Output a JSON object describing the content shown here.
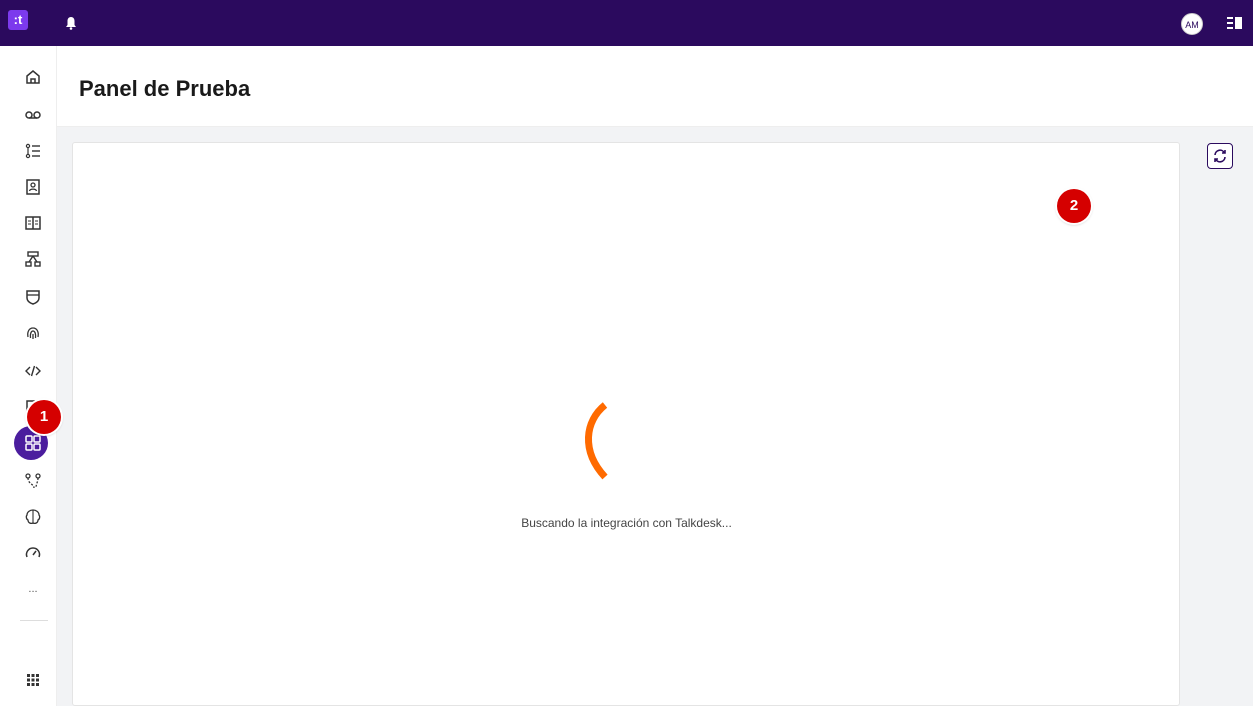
{
  "topbar": {
    "logo": ":t",
    "avatar_initials": "AM",
    "icons": [
      "bell-icon",
      "panel-toggle-icon"
    ]
  },
  "sidebar": {
    "items": [
      {
        "name": "home-icon"
      },
      {
        "name": "voicemail-icon"
      },
      {
        "name": "list-icon"
      },
      {
        "name": "contacts-icon"
      },
      {
        "name": "book-icon"
      },
      {
        "name": "flow-icon"
      },
      {
        "name": "shield-icon"
      },
      {
        "name": "fingerprint-icon"
      },
      {
        "name": "code-icon"
      },
      {
        "name": "edit-icon"
      },
      {
        "name": "dashboard-icon"
      },
      {
        "name": "routing-icon"
      },
      {
        "name": "brain-icon"
      },
      {
        "name": "gauge-icon"
      },
      {
        "name": "more-icon",
        "label": "..."
      },
      {
        "name": "apps-grid-icon"
      }
    ],
    "active": "dashboard-icon"
  },
  "header": {
    "title": "Panel de Prueba"
  },
  "main": {
    "loading_text": "Buscando la integración con Talkdesk..."
  },
  "markers": [
    {
      "label": "1"
    },
    {
      "label": "2"
    }
  ],
  "colors": {
    "topbar": "#2b0a5e",
    "accent": "#4b1d9e",
    "spinner": "#ff6a00",
    "marker": "#d50000"
  }
}
